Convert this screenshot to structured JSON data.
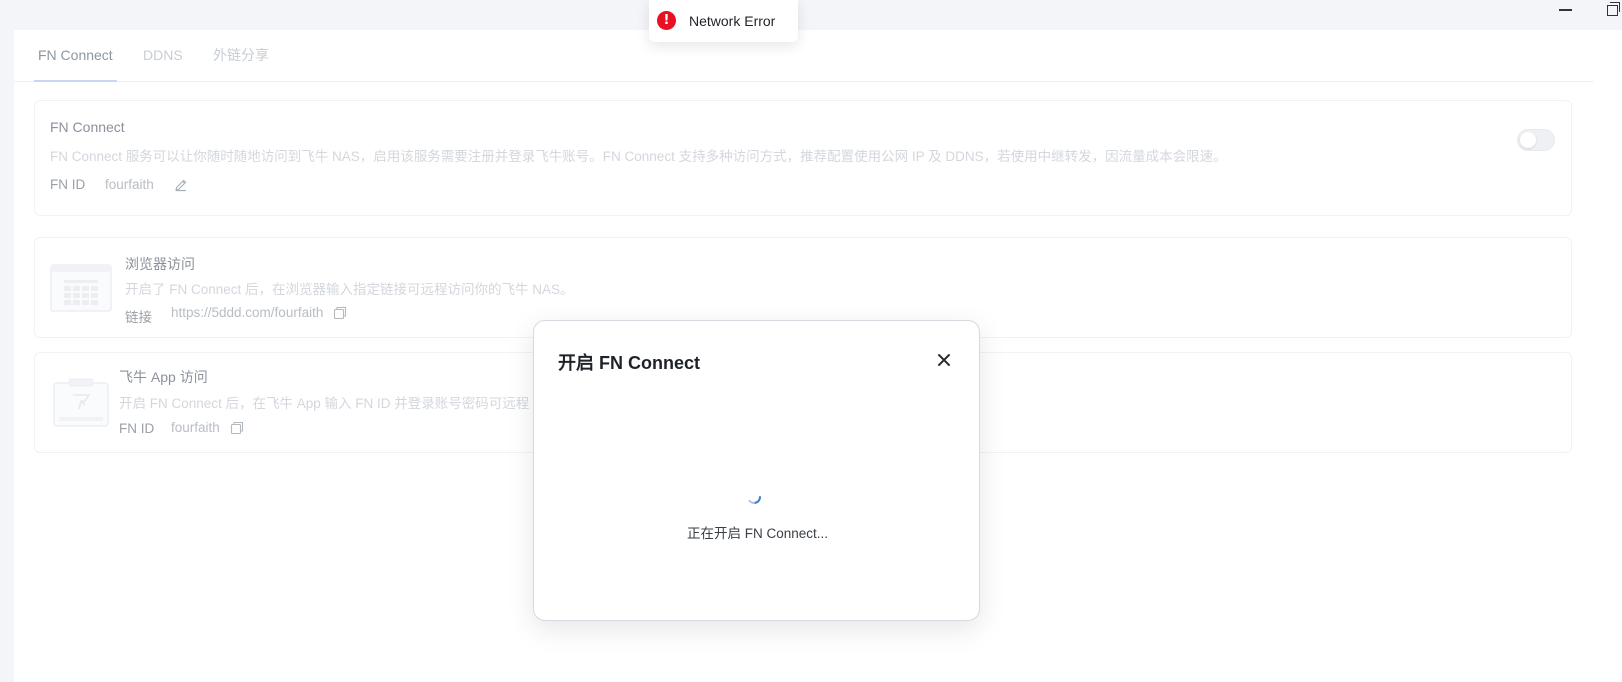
{
  "toast": {
    "icon": "error-icon",
    "message": "Network Error",
    "color": "#e81123"
  },
  "tabs": [
    {
      "label": "FN Connect",
      "active": true
    },
    {
      "label": "DDNS",
      "active": false
    },
    {
      "label": "外链分享",
      "active": false
    }
  ],
  "connect_card": {
    "title": "FN Connect",
    "description": "FN Connect 服务可以让你随时随地访问到飞牛 NAS，启用该服务需要注册并登录飞牛账号。FN Connect 支持多种访问方式，推荐配置使用公网 IP 及 DDNS，若使用中继转发，因流量成本会限速。",
    "id_label": "FN ID",
    "id_value": "fourfaith",
    "edit_icon": "edit-icon",
    "toggle_on": false
  },
  "browser_card": {
    "title": "浏览器访问",
    "description": "开启了 FN Connect 后，在浏览器输入指定链接可远程访问你的飞牛 NAS。",
    "link_label": "链接",
    "link_value": "https://5ddd.com/fourfaith",
    "copy_icon": "copy-icon"
  },
  "app_card": {
    "title": "飞牛 App 访问",
    "description": "开启 FN Connect 后，在飞牛 App 输入 FN ID 并登录账号密码可远程",
    "id_label": "FN ID",
    "id_value": "fourfaith",
    "copy_icon": "copy-icon"
  },
  "modal": {
    "title": "开启 FN Connect",
    "status": "正在开启 FN Connect...",
    "close_icon": "close-icon"
  },
  "colors": {
    "accent": "#3b7ddd",
    "error": "#e81123"
  }
}
